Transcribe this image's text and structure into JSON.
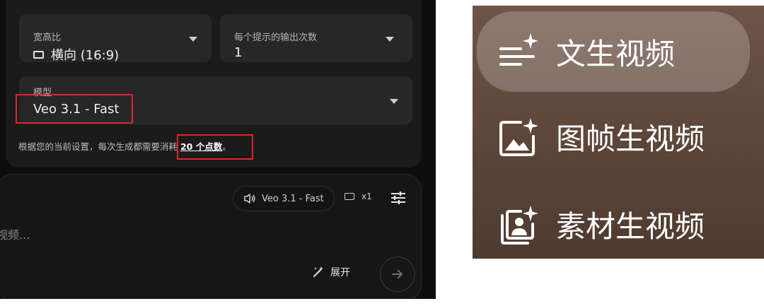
{
  "settings": {
    "aspect": {
      "label": "宽高比",
      "value": "横向 (16:9)"
    },
    "outputs": {
      "label": "每个提示的输出次数",
      "value": "1"
    },
    "model": {
      "label": "模型",
      "value": "Veo 3.1 - Fast"
    },
    "cost_note": {
      "prefix": "根据您的当前设置，每次生成都需要消耗 ",
      "points": "20 个点数",
      "suffix": "。"
    }
  },
  "prompt_bar": {
    "model_chip": "Veo 3.1 - Fast",
    "count": "x1",
    "placeholder": "视频...",
    "expand_label": "展开"
  },
  "mode_menu": {
    "items": [
      {
        "label": "文生视频",
        "icon": "text-sparkle-icon",
        "selected": true
      },
      {
        "label": "图帧生视频",
        "icon": "image-sparkle-icon",
        "selected": false
      },
      {
        "label": "素材生视频",
        "icon": "portrait-stack-sparkle-icon",
        "selected": false
      }
    ]
  },
  "colors": {
    "highlight": "#e0242e",
    "panel_bg": "#0e0e0e",
    "menu_bg": "#6e5448"
  }
}
